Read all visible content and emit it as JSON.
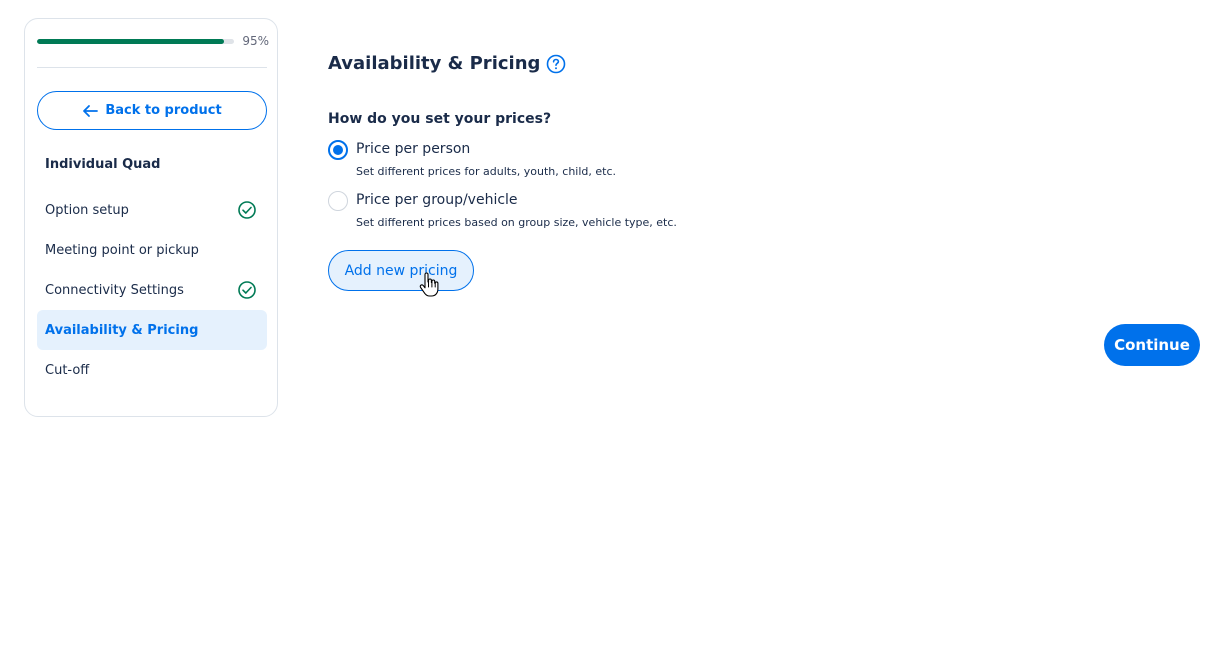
{
  "colors": {
    "accent": "#0071eb",
    "success": "#007a55",
    "active_bg": "#e5f1fd",
    "text": "#1a2b49"
  },
  "sidebar": {
    "progress": {
      "value": 0.95,
      "label": "95%"
    },
    "back_button": {
      "label": "Back to product",
      "icon": "arrow-left-icon"
    },
    "product_title": "Individual Quad",
    "items": [
      {
        "label": "Option setup",
        "completed": true,
        "active": false
      },
      {
        "label": "Meeting point or pickup",
        "completed": false,
        "active": false
      },
      {
        "label": "Connectivity Settings",
        "completed": true,
        "active": false
      },
      {
        "label": "Availability & Pricing",
        "completed": false,
        "active": true
      },
      {
        "label": "Cut-off",
        "completed": false,
        "active": false
      }
    ]
  },
  "main": {
    "title": "Availability & Pricing",
    "help_icon": "question-circle-icon",
    "question": "How do you set your prices?",
    "options": [
      {
        "label": "Price per person",
        "description": "Set different prices for adults, youth, child, etc.",
        "selected": true
      },
      {
        "label": "Price per group/vehicle",
        "description": "Set different prices based on group size, vehicle type, etc.",
        "selected": false
      }
    ],
    "add_pricing_label": "Add new pricing",
    "continue_label": "Continue"
  }
}
